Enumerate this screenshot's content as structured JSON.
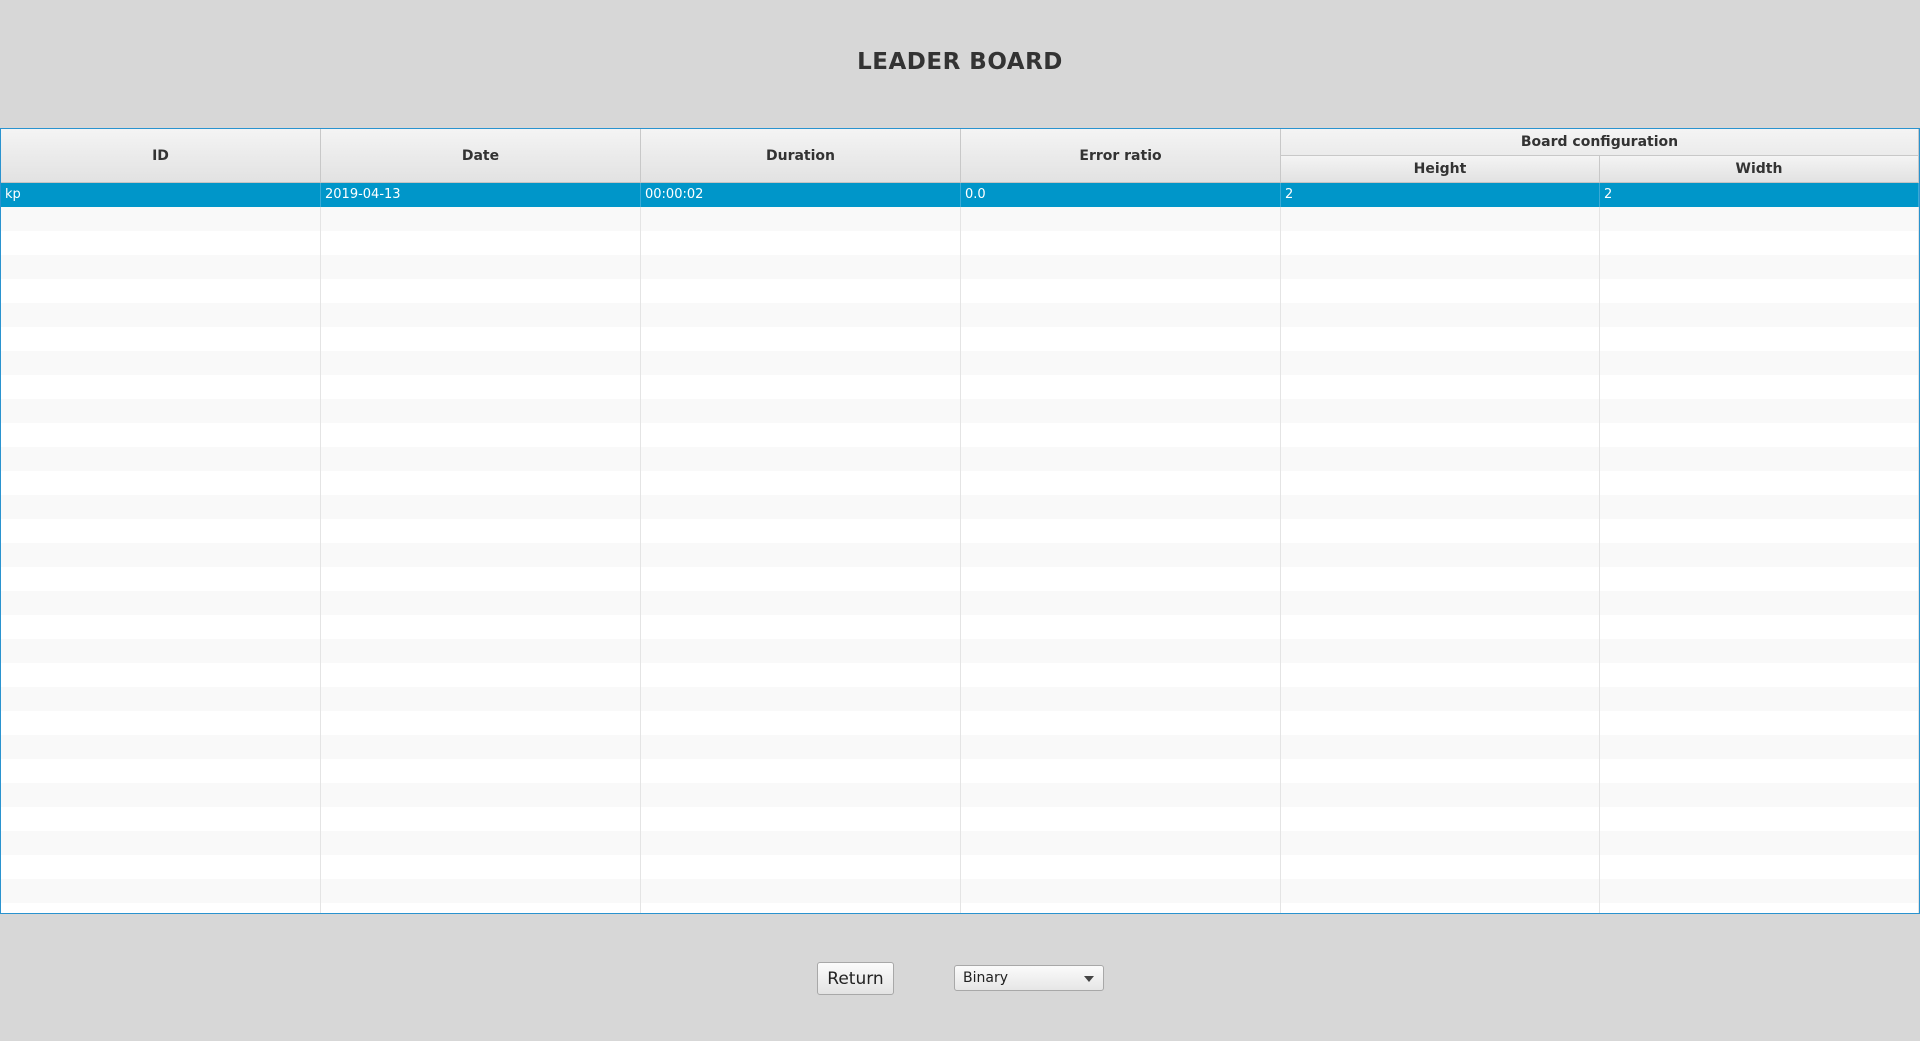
{
  "title": "LEADER BOARD",
  "table": {
    "columns": {
      "id": "ID",
      "date": "Date",
      "duration": "Duration",
      "error_ratio": "Error ratio",
      "board_configuration": "Board configuration",
      "height": "Height",
      "width": "Width"
    },
    "rows": [
      {
        "id": "kp",
        "date": "2019-04-13",
        "duration": "00:00:02",
        "error_ratio": "0.0",
        "height": "2",
        "width": "2",
        "selected": true
      }
    ]
  },
  "buttons": {
    "return_label": "Return"
  },
  "mode_select": {
    "selected": "Binary"
  },
  "colors": {
    "background": "#d7d7d7",
    "selection": "#0096c9",
    "table_border": "#2a93cf"
  }
}
